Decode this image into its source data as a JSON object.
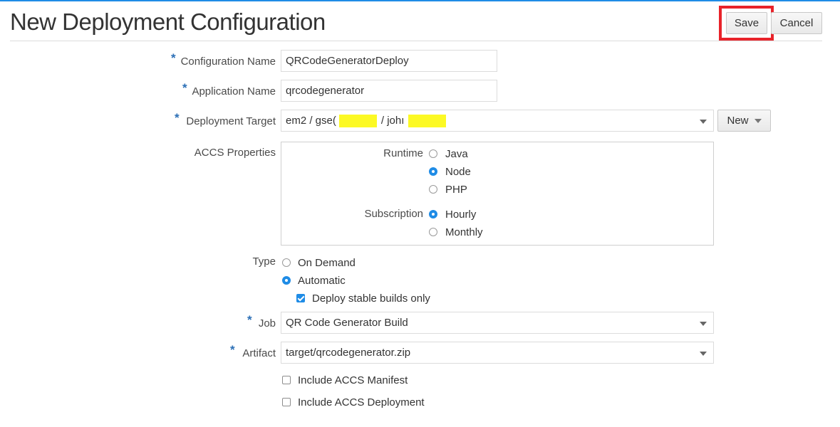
{
  "header": {
    "title": "New Deployment Configuration",
    "save_label": "Save",
    "cancel_label": "Cancel",
    "highlight_color": "#e8232a"
  },
  "form": {
    "config_name": {
      "label": "Configuration Name",
      "value": "QRCodeGeneratorDeploy",
      "required": true
    },
    "app_name": {
      "label": "Application Name",
      "value": "qrcodegenerator",
      "required": true
    },
    "target": {
      "label": "Deployment Target",
      "value_part1": "em2 / gse(",
      "value_part2": " / johı",
      "required": true,
      "new_label": "New"
    },
    "accs": {
      "label": "ACCS Properties",
      "runtime_label": "Runtime",
      "runtime_options": [
        "Java",
        "Node",
        "PHP"
      ],
      "runtime_selected": "Node",
      "subscription_label": "Subscription",
      "subscription_options": [
        "Hourly",
        "Monthly"
      ],
      "subscription_selected": "Hourly"
    },
    "type": {
      "label": "Type",
      "options": [
        "On Demand",
        "Automatic"
      ],
      "selected": "Automatic",
      "stable_label": "Deploy stable builds only",
      "stable_checked": true
    },
    "job": {
      "label": "Job",
      "value": "QR Code Generator Build",
      "required": true
    },
    "artifact": {
      "label": "Artifact",
      "value": "target/qrcodegenerator.zip",
      "required": true
    },
    "include_manifest": {
      "label": "Include ACCS Manifest",
      "checked": false
    },
    "include_deployment": {
      "label": "Include ACCS Deployment",
      "checked": false
    }
  },
  "colors": {
    "accent": "#1f8ce6",
    "required_star": "#2b6fb6",
    "redaction": "#fcf924"
  }
}
